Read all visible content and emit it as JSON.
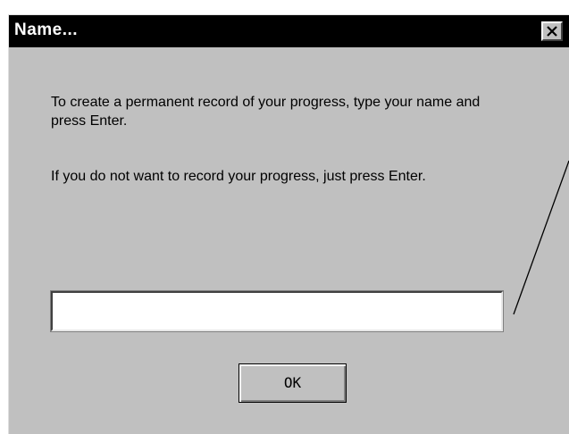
{
  "dialog": {
    "title": "Name...",
    "message_line1": "To create a permanent record of your progress, type your name and press Enter.",
    "message_line2": "If you do not want to record your progress, just press Enter.",
    "name_value": "",
    "ok_label": "OK"
  },
  "icons": {
    "close": "close-icon"
  },
  "colors": {
    "title_bar": "#000000",
    "dialog_bg": "#c0c0c0",
    "input_bg": "#ffffff"
  }
}
